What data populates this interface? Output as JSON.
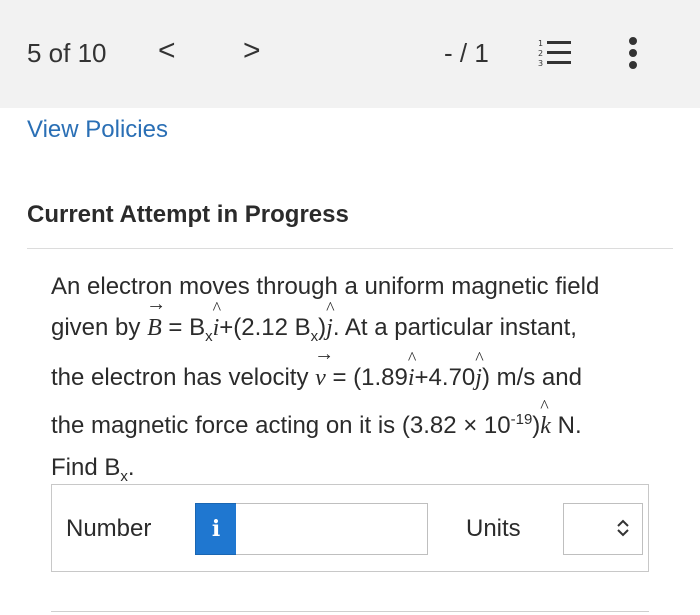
{
  "topbar": {
    "position": "5 of 10",
    "prev_glyph": "<",
    "next_glyph": ">",
    "score": "- / 1"
  },
  "content": {
    "policies_link": "View Policies",
    "heading": "Current Attempt in Progress",
    "question": {
      "line1": "An electron moves through a uniform magnetic field",
      "l2_a": "given by ",
      "l2_B": "B",
      "l2_b": " = B",
      "l2_x": "x",
      "l2_i": "i",
      "l2_c": "+(2.12 B",
      "l2_x2": "x",
      "l2_d": ")",
      "l2_j": "j",
      "l2_e": ". At a particular instant,",
      "l3_a": "the electron has velocity ",
      "l3_v": "v",
      "l3_b": " = (1.89",
      "l3_i": "i",
      "l3_c": "+4.70",
      "l3_j": "j",
      "l3_d": ") m/s and",
      "l4_a": "the magnetic force acting on it is (3.82 × 10",
      "l4_exp": "-19",
      "l4_b": ")",
      "l4_k": "k",
      "l4_c": " N.",
      "l5_a": "Find B",
      "l5_x": "x",
      "l5_b": "."
    },
    "answer": {
      "number_label": "Number",
      "info_glyph": "i",
      "number_value": "",
      "units_label": "Units",
      "units_value": ""
    }
  },
  "icons": {
    "list": "numbered-list-icon",
    "more": "more-vertical-icon",
    "chevron": "up-down-chevron-icon"
  },
  "colors": {
    "link": "#2a6fb5",
    "info_button": "#1f77d0",
    "topbar_bg": "#f2f2f2"
  }
}
